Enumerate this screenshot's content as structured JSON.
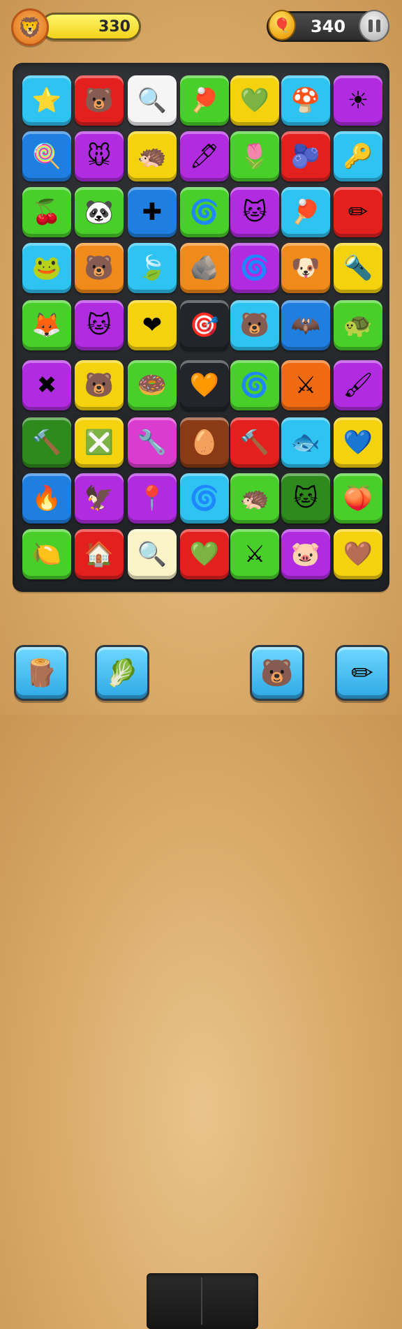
{
  "hud": {
    "avatar_icon": "🦁",
    "score": "330",
    "coins": "340",
    "coin_icon": "🎈",
    "pause_icon": "pause-icon"
  },
  "board": {
    "rows": [
      [
        {
          "color": "#2ec3f0",
          "icon": "⭐",
          "name": "star-icon"
        },
        {
          "color": "#e4201f",
          "icon": "🐻",
          "name": "bear-icon"
        },
        {
          "color": "#f5f5f5",
          "icon": "🔍",
          "name": "lollipop-icon"
        },
        {
          "color": "#48cf2a",
          "icon": "🏓",
          "name": "paddle-icon"
        },
        {
          "color": "#f4d20d",
          "icon": "💚",
          "name": "leaf-heart-icon"
        },
        {
          "color": "#2ec3f0",
          "icon": "🍄",
          "name": "mushroom-icon"
        },
        {
          "color": "#b12ce0",
          "icon": "☀",
          "name": "sun-icon"
        }
      ],
      [
        {
          "color": "#1f7fe0",
          "icon": "🍭",
          "name": "popsicle-icon"
        },
        {
          "color": "#b12ce0",
          "icon": "🐭",
          "name": "mouse-icon"
        },
        {
          "color": "#f4d20d",
          "icon": "🦔",
          "name": "urchin-icon"
        },
        {
          "color": "#b12ce0",
          "icon": "🖊",
          "name": "pencil-icon"
        },
        {
          "color": "#48cf2a",
          "icon": "🌷",
          "name": "tulip-icon"
        },
        {
          "color": "#e4201f",
          "icon": "🫐",
          "name": "blob-icon"
        },
        {
          "color": "#2ec3f0",
          "icon": "🔑",
          "name": "key-icon"
        }
      ],
      [
        {
          "color": "#48cf2a",
          "icon": "🍒",
          "name": "cherry-icon"
        },
        {
          "color": "#48cf2a",
          "icon": "🐼",
          "name": "panda-icon"
        },
        {
          "color": "#1f7fe0",
          "icon": "✚",
          "name": "cross-icon"
        },
        {
          "color": "#48cf2a",
          "icon": "🌀",
          "name": "swirl-icon"
        },
        {
          "color": "#b12ce0",
          "icon": "🐱",
          "name": "cat-icon"
        },
        {
          "color": "#2ec3f0",
          "icon": "🏓",
          "name": "paddle-icon"
        },
        {
          "color": "#e4201f",
          "icon": "✏",
          "name": "pencil-icon"
        }
      ],
      [
        {
          "color": "#2ec3f0",
          "icon": "🐸",
          "name": "frog-icon"
        },
        {
          "color": "#f08a1a",
          "icon": "🐻",
          "name": "bear-icon"
        },
        {
          "color": "#2ec3f0",
          "icon": "🍃",
          "name": "leaf-icon"
        },
        {
          "color": "#f08a1a",
          "icon": "🪨",
          "name": "stone-icon"
        },
        {
          "color": "#b12ce0",
          "icon": "🌀",
          "name": "swirl-icon"
        },
        {
          "color": "#f08a1a",
          "icon": "🐶",
          "name": "dog-icon"
        },
        {
          "color": "#f4d20d",
          "icon": "🔦",
          "name": "flashlight-icon"
        }
      ],
      [
        {
          "color": "#48cf2a",
          "icon": "🦊",
          "name": "fox-icon"
        },
        {
          "color": "#b12ce0",
          "icon": "🐱",
          "name": "cat-icon"
        },
        {
          "color": "#f4d20d",
          "icon": "❤",
          "name": "heart-icon"
        },
        {
          "color": "#22252a",
          "icon": "🎯",
          "name": "target-icon"
        },
        {
          "color": "#2ec3f0",
          "icon": "🐻",
          "name": "bear-icon"
        },
        {
          "color": "#1f7fe0",
          "icon": "🦇",
          "name": "bat-icon"
        },
        {
          "color": "#48cf2a",
          "icon": "🐢",
          "name": "turtle-icon"
        }
      ],
      [
        {
          "color": "#b12ce0",
          "icon": "✖",
          "name": "x-icon"
        },
        {
          "color": "#f4d20d",
          "icon": "🐻",
          "name": "bear-icon"
        },
        {
          "color": "#48cf2a",
          "icon": "🍩",
          "name": "donut-icon"
        },
        {
          "color": "#22252a",
          "icon": "🧡",
          "name": "heart-icon"
        },
        {
          "color": "#48cf2a",
          "icon": "🌀",
          "name": "swirl-icon"
        },
        {
          "color": "#f06a12",
          "icon": "⚔",
          "name": "swords-icon"
        },
        {
          "color": "#b12ce0",
          "icon": "🖌",
          "name": "brush-icon"
        }
      ],
      [
        {
          "color": "#2f8a1e",
          "icon": "🔨",
          "name": "hammer-icon"
        },
        {
          "color": "#f4d20d",
          "icon": "❎",
          "name": "cross-icon"
        },
        {
          "color": "#d93ccf",
          "icon": "🔧",
          "name": "wrench-icon"
        },
        {
          "color": "#8a3a14",
          "icon": "🥚",
          "name": "seed-icon"
        },
        {
          "color": "#e4201f",
          "icon": "🔨",
          "name": "hammer-icon"
        },
        {
          "color": "#2ec3f0",
          "icon": "🐟",
          "name": "fish-icon"
        },
        {
          "color": "#f4d20d",
          "icon": "💙",
          "name": "heart-icon"
        }
      ],
      [
        {
          "color": "#1f7fe0",
          "icon": "🔥",
          "name": "flame-icon"
        },
        {
          "color": "#b12ce0",
          "icon": "🦅",
          "name": "bird-icon"
        },
        {
          "color": "#b12ce0",
          "icon": "📍",
          "name": "pin-icon"
        },
        {
          "color": "#2ec3f0",
          "icon": "🌀",
          "name": "swirl-icon"
        },
        {
          "color": "#48cf2a",
          "icon": "🦔",
          "name": "urchin-icon"
        },
        {
          "color": "#2f8a1e",
          "icon": "🐱",
          "name": "cat-icon"
        },
        {
          "color": "#48cf2a",
          "icon": "🍑",
          "name": "peach-icon"
        }
      ],
      [
        {
          "color": "#48cf2a",
          "icon": "🍋",
          "name": "lemon-icon"
        },
        {
          "color": "#e4201f",
          "icon": "🏠",
          "name": "house-icon"
        },
        {
          "color": "#faf4c8",
          "icon": "🔍",
          "name": "magnifier-icon"
        },
        {
          "color": "#e4201f",
          "icon": "💚",
          "name": "heart-icon"
        },
        {
          "color": "#48cf2a",
          "icon": "⚔",
          "name": "swords-icon"
        },
        {
          "color": "#b12ce0",
          "icon": "🐷",
          "name": "pig-icon"
        },
        {
          "color": "#f4d20d",
          "icon": "🤎",
          "name": "heart-icon"
        }
      ]
    ]
  },
  "tools": [
    {
      "icon": "🪵",
      "name": "rolling-pin-icon"
    },
    {
      "icon": "🥬",
      "name": "leaf-icon"
    },
    {
      "icon": "🐻",
      "name": "bear-icon"
    },
    {
      "icon": "✏",
      "name": "pencil-icon"
    }
  ]
}
